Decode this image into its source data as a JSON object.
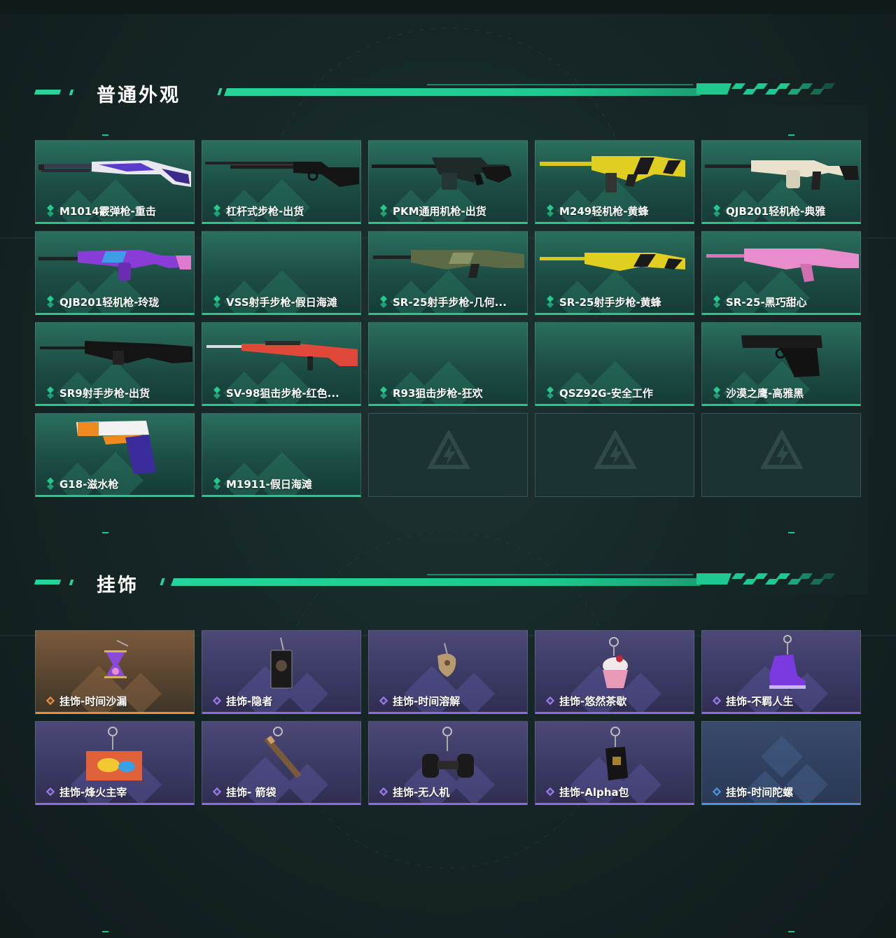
{
  "sections": [
    {
      "title": "普通外观",
      "items": [
        {
          "label": "M1014霰弹枪-重击",
          "icon": "shotgun-icon"
        },
        {
          "label": "杠杆式步枪-出货",
          "icon": "lever-rifle-icon"
        },
        {
          "label": "PKM通用机枪-出货",
          "icon": "machine-gun-icon"
        },
        {
          "label": "M249轻机枪-黄蜂",
          "icon": "machine-gun-icon"
        },
        {
          "label": "QJB201轻机枪-典雅",
          "icon": "machine-gun-icon"
        },
        {
          "label": "QJB201轻机枪-玲珑",
          "icon": "machine-gun-icon"
        },
        {
          "label": "VSS射手步枪-假日海滩",
          "icon": ""
        },
        {
          "label": "SR-25射手步枪-几何...",
          "icon": "marksman-rifle-icon"
        },
        {
          "label": "SR-25射手步枪-黄蜂",
          "icon": "marksman-rifle-icon"
        },
        {
          "label": "SR-25-黑巧甜心",
          "icon": "marksman-rifle-icon"
        },
        {
          "label": "SR9射手步枪-出货",
          "icon": "marksman-rifle-icon"
        },
        {
          "label": "SV-98狙击步枪-红色...",
          "icon": "sniper-rifle-icon"
        },
        {
          "label": "R93狙击步枪-狂欢",
          "icon": ""
        },
        {
          "label": "QSZ92G-安全工作",
          "icon": ""
        },
        {
          "label": "沙漠之鹰-高雅黑",
          "icon": "pistol-icon"
        },
        {
          "label": "G18-滋水枪",
          "icon": "water-pistol-icon"
        },
        {
          "label": "M1911-假日海滩",
          "icon": ""
        }
      ]
    },
    {
      "title": "挂饰",
      "items": [
        {
          "label": "挂饰-时间沙漏",
          "icon": "hourglass-charm-icon",
          "rarity": "orange"
        },
        {
          "label": "挂饰-隐者",
          "icon": "card-charm-icon",
          "rarity": "purple"
        },
        {
          "label": "挂饰-时间溶解",
          "icon": "melting-clock-charm-icon",
          "rarity": "purple"
        },
        {
          "label": "挂饰-悠然茶歇",
          "icon": "cupcake-charm-icon",
          "rarity": "purple"
        },
        {
          "label": "挂饰-不羁人生",
          "icon": "sneaker-charm-icon",
          "rarity": "purple"
        },
        {
          "label": "挂饰-烽火主宰",
          "icon": "container-charm-icon",
          "rarity": "purple"
        },
        {
          "label": "挂饰- 箭袋",
          "icon": "quiver-charm-icon",
          "rarity": "purple"
        },
        {
          "label": "挂饰-无人机",
          "icon": "drone-charm-icon",
          "rarity": "purple"
        },
        {
          "label": "挂饰-Alpha包",
          "icon": "pouch-charm-icon",
          "rarity": "purple"
        },
        {
          "label": "挂饰-时间陀螺",
          "icon": "",
          "rarity": "blue"
        }
      ]
    }
  ],
  "colors": {
    "green_accent": "#25c98b",
    "purple_accent": "#8b6de2",
    "orange_accent": "#e88d3b",
    "blue_accent": "#4a94e0"
  }
}
